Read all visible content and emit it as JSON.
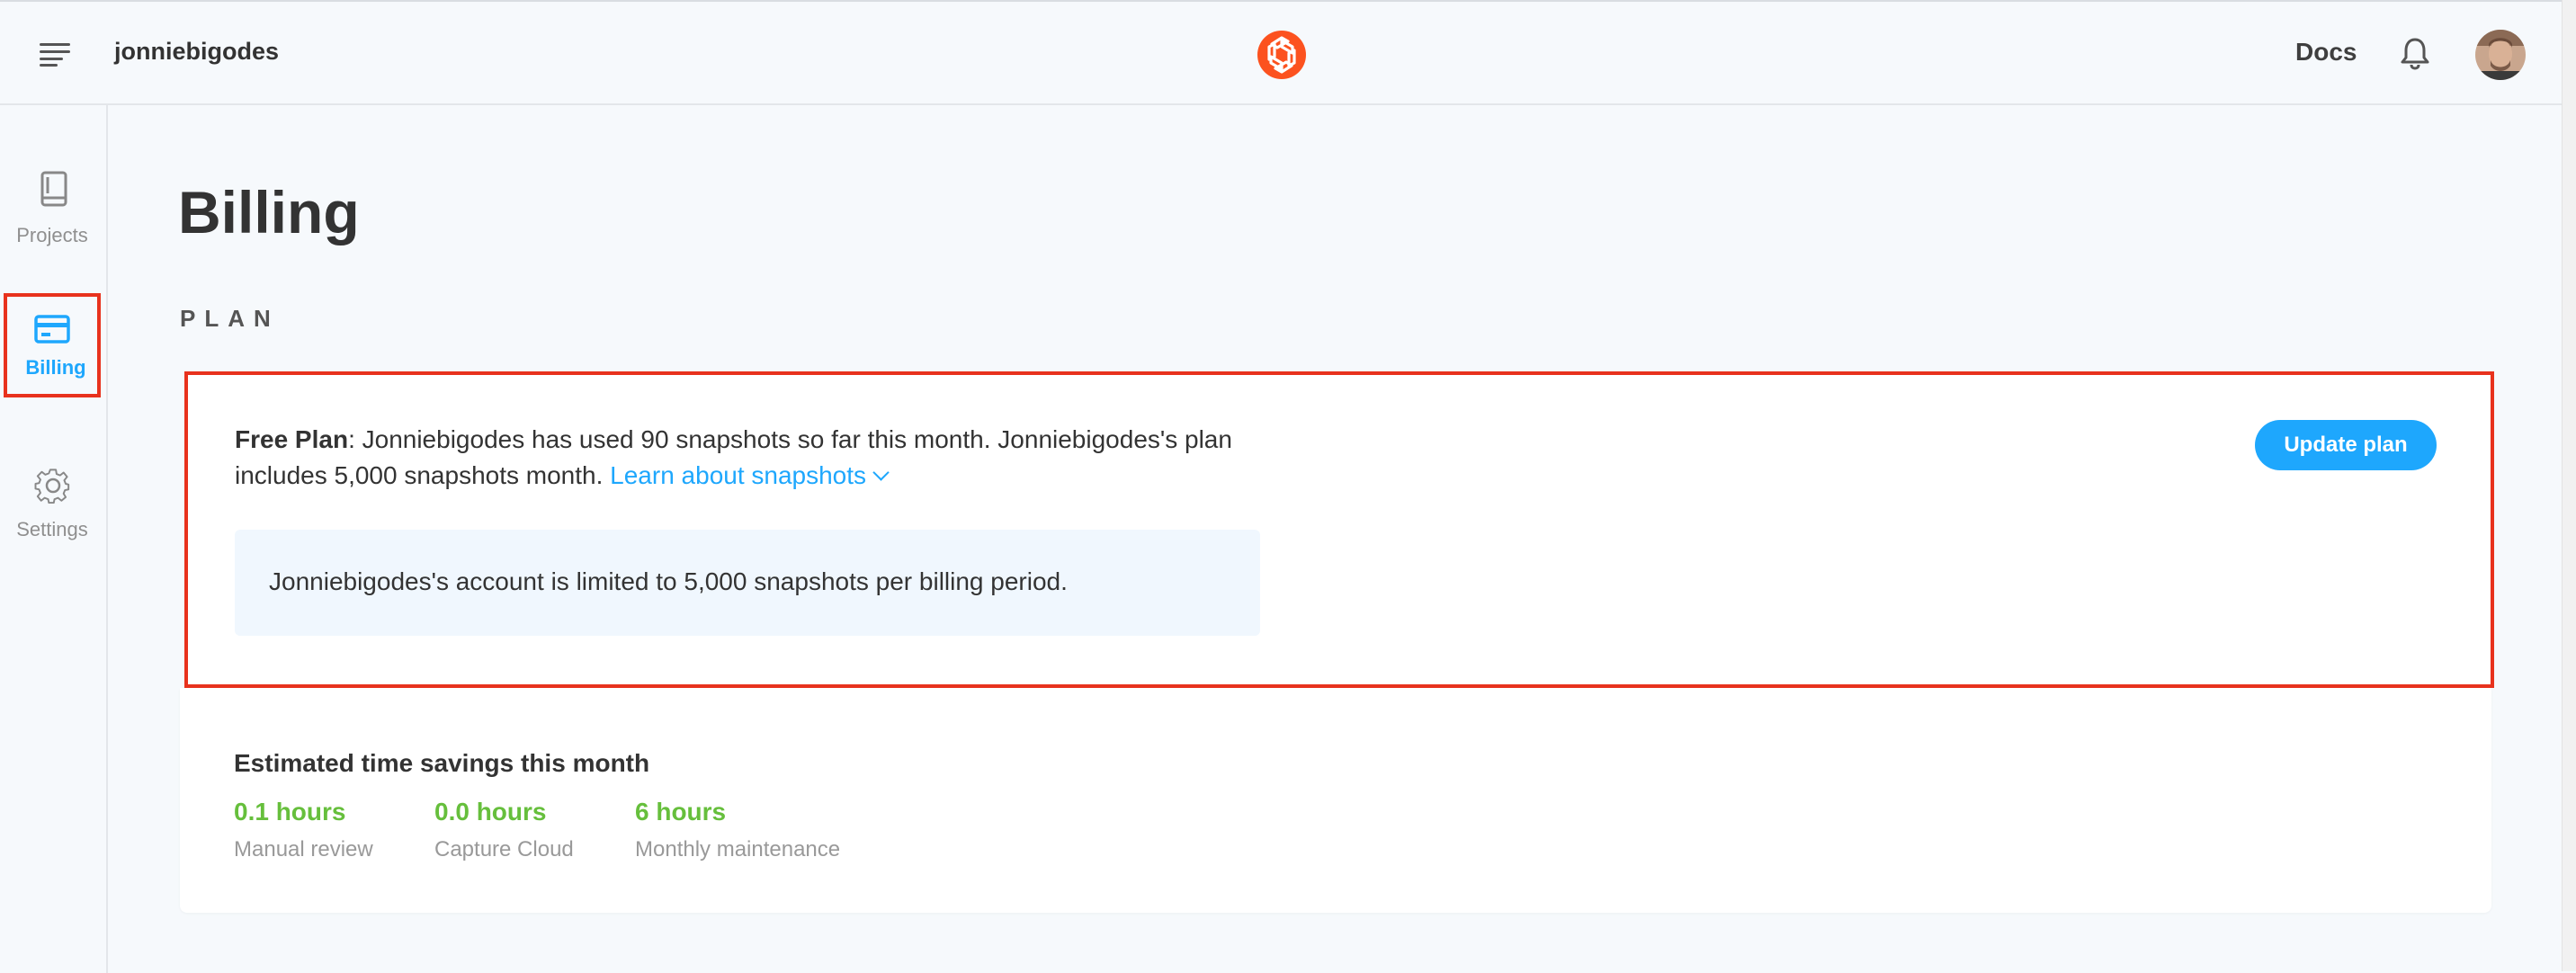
{
  "header": {
    "account_name": "jonniebigodes",
    "docs_label": "Docs",
    "brand_color": "#fc521f"
  },
  "sidebar": {
    "items": [
      {
        "label": "Projects",
        "icon": "book-icon",
        "active": false
      },
      {
        "label": "Billing",
        "icon": "credit-card-icon",
        "active": true
      },
      {
        "label": "Settings",
        "icon": "gear-icon",
        "active": false
      }
    ]
  },
  "main": {
    "title": "Billing",
    "section_label": "PLAN",
    "plan": {
      "plan_name": "Free Plan",
      "description": ": Jonniebigodes has used 90 snapshots so far this month. Jonniebigodes's plan includes 5,000 snapshots month. ",
      "learn_link": "Learn about snapshots",
      "limit_notice": "Jonniebigodes's account is limited to 5,000 snapshots per billing period.",
      "update_button": "Update plan"
    },
    "savings": {
      "title": "Estimated time savings this month",
      "stats": [
        {
          "value": "0.1 hours",
          "label": "Manual review"
        },
        {
          "value": "0.0 hours",
          "label": "Capture Cloud"
        },
        {
          "value": "6 hours",
          "label": "Monthly maintenance"
        }
      ]
    }
  },
  "colors": {
    "accent": "#1ea7fd",
    "highlight": "#e8321d",
    "success": "#66bf3c"
  }
}
